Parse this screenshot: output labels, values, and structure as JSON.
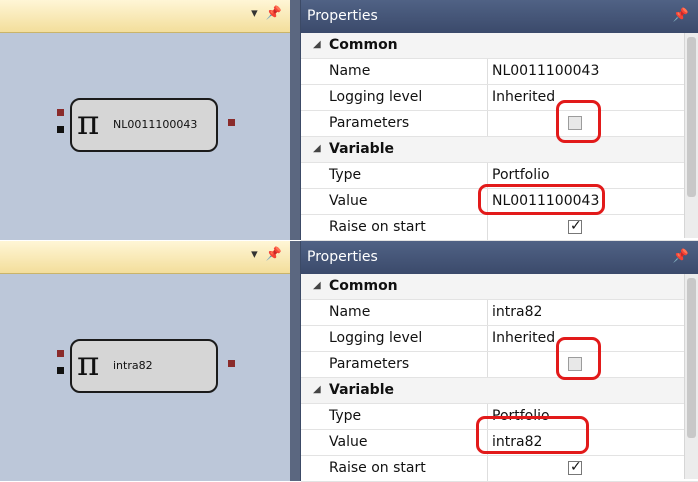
{
  "panels": [
    {
      "canvas": {
        "header_icons": "▾ 📌",
        "node": {
          "symbol": "π",
          "label": "NL0011100043"
        }
      },
      "properties": {
        "title": "Properties",
        "pin": "📌",
        "common_label": "Common",
        "name_label": "Name",
        "name_value": "NL0011100043",
        "logging_label": "Logging level",
        "logging_value": "Inherited",
        "parameters_label": "Parameters",
        "variable_label": "Variable",
        "type_label": "Type",
        "type_value": "Portfolio",
        "value_label": "Value",
        "value_value": "NL0011100043",
        "raise_label": "Raise on start"
      }
    },
    {
      "canvas": {
        "header_icons": "▾ 📌",
        "node": {
          "symbol": "π",
          "label": "intra82"
        }
      },
      "properties": {
        "title": "Properties",
        "pin": "📌",
        "common_label": "Common",
        "name_label": "Name",
        "name_value": "intra82",
        "logging_label": "Logging level",
        "logging_value": "Inherited",
        "parameters_label": "Parameters",
        "variable_label": "Variable",
        "type_label": "Type",
        "type_value": "Portfolio",
        "value_label": "Value",
        "value_value": "intra82",
        "raise_label": "Raise on start"
      }
    }
  ],
  "colors": {
    "canvas_bg": "#bcc7d9",
    "header_gold": "#f3de9b",
    "panel_header": "#3b4a6b",
    "highlight_red": "#e21a1a"
  }
}
